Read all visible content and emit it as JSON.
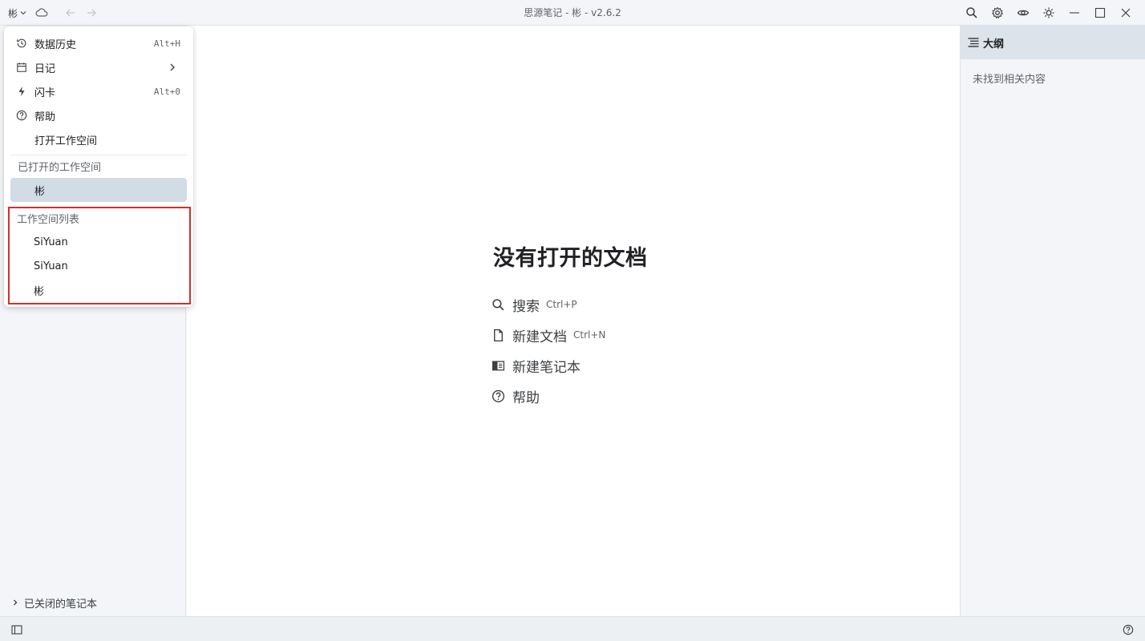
{
  "app": {
    "window_title": "思源笔记 - 彬 - v2.6.2",
    "workspace_name": "彬"
  },
  "titlebar": {
    "icons": [
      "cloud-icon",
      "back-icon",
      "forward-icon",
      "search-icon",
      "gear-icon",
      "eye-icon",
      "sun-icon",
      "minimize-icon",
      "maximize-icon",
      "close-icon"
    ]
  },
  "menu": {
    "items": [
      {
        "label": "数据历史",
        "shortcut": "Alt+H",
        "icon": "history-icon"
      },
      {
        "label": "日记",
        "icon": "calendar-icon"
      },
      {
        "label": "闪卡",
        "shortcut": "Alt+0",
        "icon": "lightning-icon"
      },
      {
        "label": "帮助",
        "icon": "help-icon"
      },
      {
        "label": "打开工作空间"
      }
    ],
    "opened_label": "已打开的工作空间",
    "opened_current": "彬",
    "list_label": "工作空间列表",
    "list_items": [
      "SiYuan",
      "SiYuan",
      "彬"
    ]
  },
  "leftdock": {
    "closed_notebooks": "已关闭的笔记本"
  },
  "main": {
    "empty_title": "没有打开的文档",
    "actions": [
      {
        "label": "搜索",
        "shortcut": "Ctrl+P"
      },
      {
        "label": "新建文档",
        "shortcut": "Ctrl+N"
      },
      {
        "label": "新建笔记本"
      },
      {
        "label": "帮助"
      }
    ]
  },
  "outline": {
    "title": "大纲",
    "empty": "未找到相关内容"
  },
  "colors": {
    "highlight_border": "#d32f2f",
    "current_workspace_bg": "#d1dce4",
    "outline_header_bg": "#dde3ea"
  }
}
